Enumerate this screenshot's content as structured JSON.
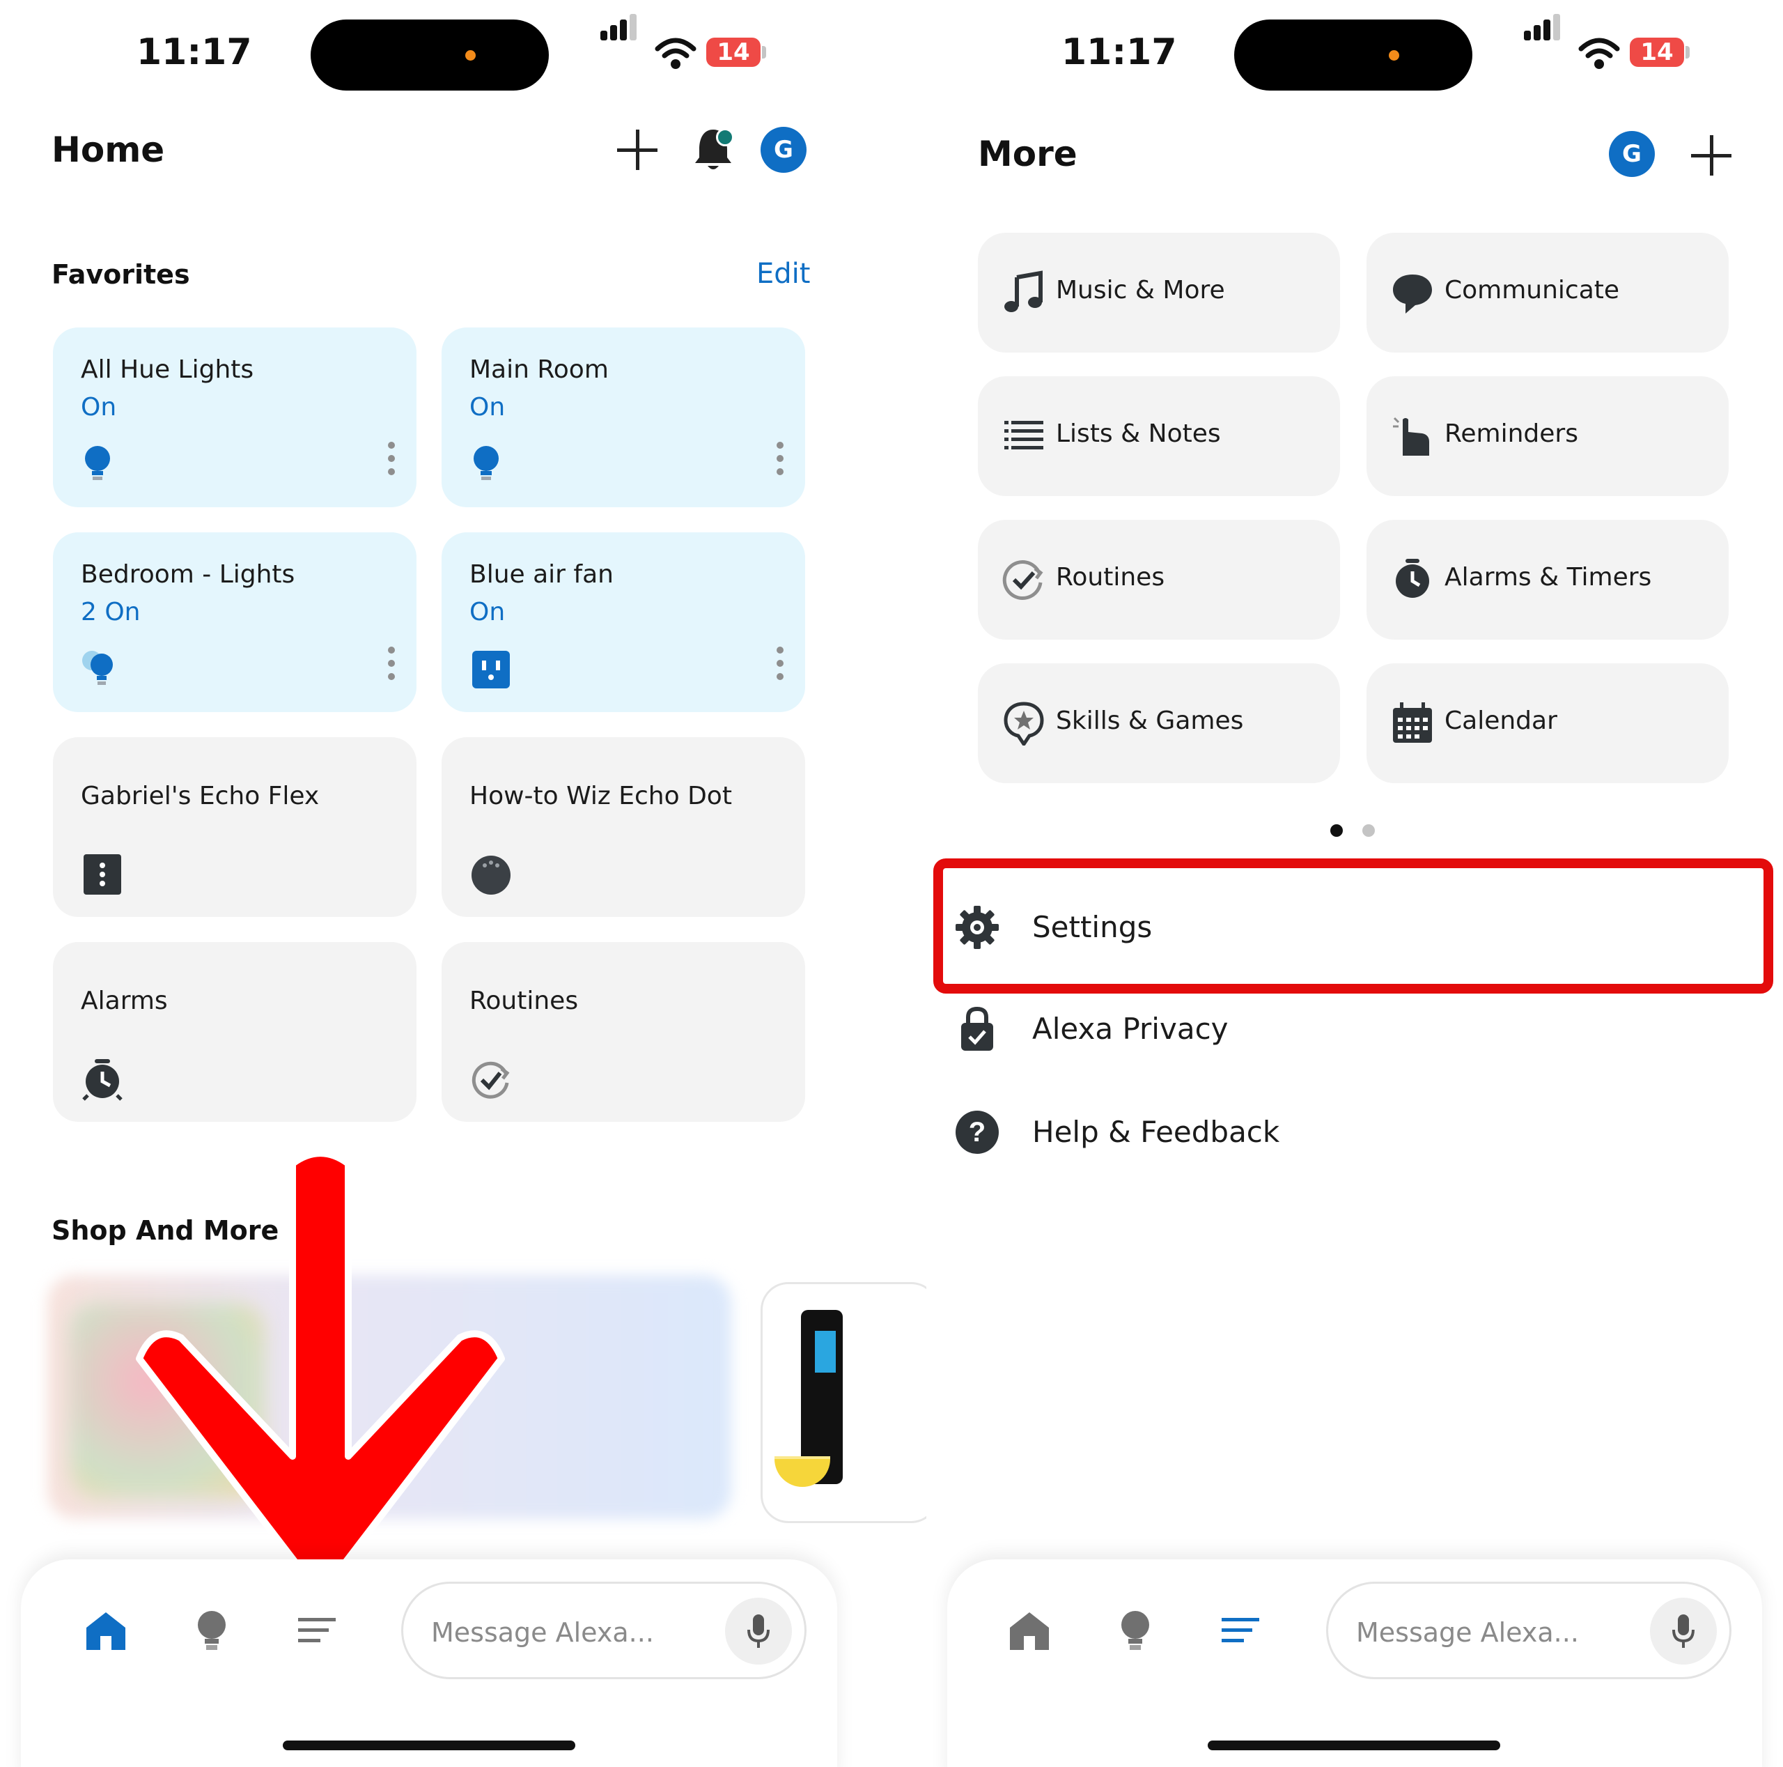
{
  "left": {
    "status": {
      "time": "11:17",
      "battery": "14"
    },
    "header": {
      "title": "Home"
    },
    "favorites": {
      "title": "Favorites",
      "edit_label": "Edit",
      "tiles": [
        {
          "name": "All Hue Lights",
          "state": "On",
          "icon": "bulb-icon"
        },
        {
          "name": "Main Room",
          "state": "On",
          "icon": "bulb-icon"
        },
        {
          "name": "Bedroom - Lights",
          "state": "2 On",
          "icon": "bulb-group-icon"
        },
        {
          "name": "Blue air fan",
          "state": "On",
          "icon": "smart-plug-icon"
        },
        {
          "name": "Gabriel's Echo Flex",
          "state": "",
          "icon": "echo-flex-icon"
        },
        {
          "name": "How-to Wiz Echo Dot",
          "state": "",
          "icon": "echo-dot-icon"
        },
        {
          "name": "Alarms",
          "state": "",
          "icon": "alarm-clock-icon"
        },
        {
          "name": "Routines",
          "state": "",
          "icon": "routines-icon"
        }
      ]
    },
    "shop": {
      "title": "Shop And More"
    },
    "bottom_nav": {
      "message_placeholder": "Message Alexa...",
      "active": "home"
    }
  },
  "right": {
    "status": {
      "time": "11:17",
      "battery": "14"
    },
    "header": {
      "title": "More",
      "avatar": "G"
    },
    "grid": [
      {
        "label": "Music & More",
        "icon": "music-note-icon"
      },
      {
        "label": "Communicate",
        "icon": "chat-bubble-icon"
      },
      {
        "label": "Lists & Notes",
        "icon": "list-icon"
      },
      {
        "label": "Reminders",
        "icon": "reminder-hand-icon"
      },
      {
        "label": "Routines",
        "icon": "routines-icon"
      },
      {
        "label": "Alarms & Timers",
        "icon": "alarm-clock-icon"
      },
      {
        "label": "Skills & Games",
        "icon": "skills-star-icon"
      },
      {
        "label": "Calendar",
        "icon": "calendar-icon"
      }
    ],
    "list": [
      {
        "label": "Settings",
        "icon": "gear-icon"
      },
      {
        "label": "Alexa Privacy",
        "icon": "privacy-lock-icon"
      },
      {
        "label": "Help & Feedback",
        "icon": "help-icon"
      }
    ],
    "bottom_nav": {
      "message_placeholder": "Message Alexa...",
      "active": "more"
    }
  },
  "left_avatar": "G",
  "colors": {
    "accent": "#0f6ec4",
    "tile_on": "#e4f6fd",
    "tile_off": "#f3f3f3",
    "highlight": "#e30b0b"
  }
}
